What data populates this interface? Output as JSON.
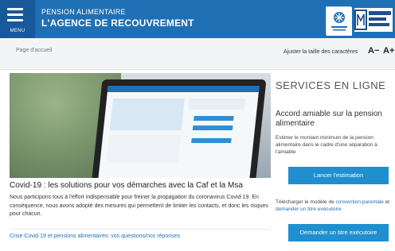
{
  "header": {
    "menu_label": "MENU",
    "title_line1": "PENSION ALIMENTAIRE",
    "title_line2": "L'AGENCE DE RECOUVREMENT",
    "brand_color": "#1f6fb4",
    "logo_right_text": "santé famille retraite services"
  },
  "toolbar": {
    "breadcrumb": "Page d'accueil",
    "text_size_label": "Ajuster la taille des caractères",
    "decrease": "A−",
    "increase": "A+"
  },
  "news": {
    "title": "Covid-19 : les solutions pour vos démarches avec la Caf et la Msa",
    "body": "Nous participons tous à l'effort indispensable pour freiner la propagation du coronavirus Covid-19. En conséquence, nous avons adopté des mesures qui permettent de limiter les contacts, et donc les risques pour chacun.",
    "link": "Crise Covid 19 et pensions alimentaires: vos questions/nos réponses"
  },
  "services": {
    "heading": "SERVICES EN LIGNE",
    "accord_title": "Accord amiable sur la pension alimentaire",
    "accord_desc": "Estimer le montant minimum de la pension alimentaire dans le cadre d'une séparation à l'amiable",
    "estimate_button": "Lancer l'estimation",
    "download_prefix": "Télécharger le modèle de ",
    "download_link1": "convention parentale",
    "download_mid": " et ",
    "download_link2": "demander un titre exécutoire",
    "request_button": "Demander un titre exécutoire",
    "button_color": "#1f8fcf"
  }
}
